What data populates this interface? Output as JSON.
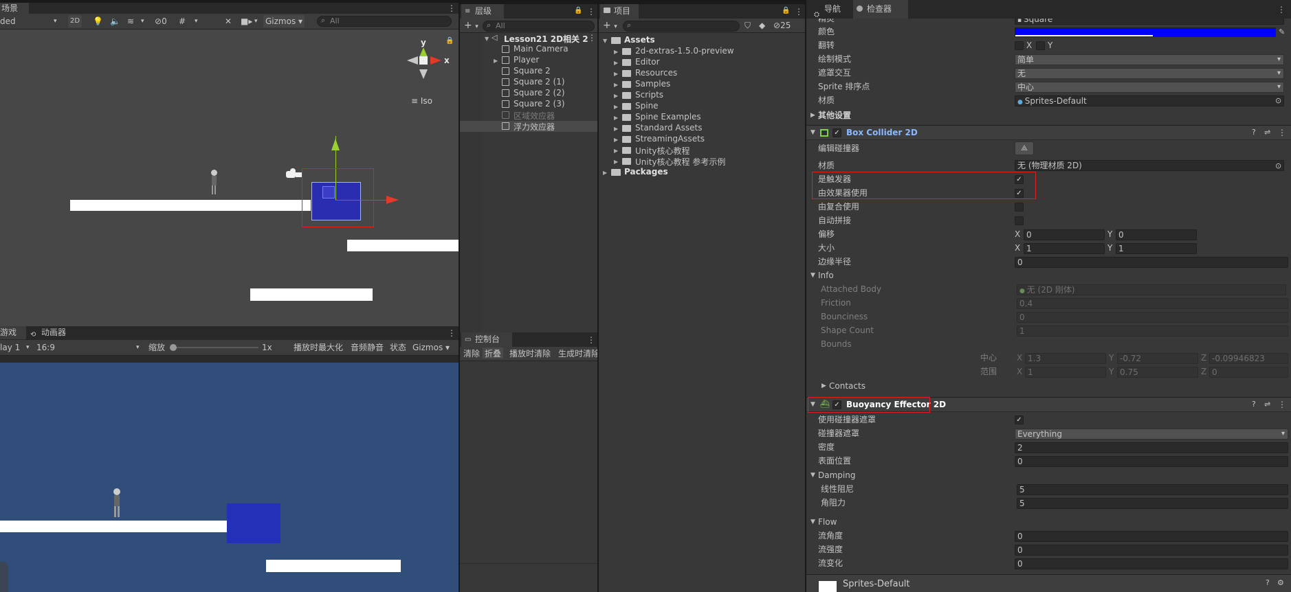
{
  "scene": {
    "tab": "场景",
    "shading": "ded",
    "btn_2d": "2D",
    "hidden_count": "0",
    "gizmos": "Gizmos",
    "search_placeholder": "All",
    "axis_y": "y",
    "axis_x": "x",
    "iso": "Iso"
  },
  "game": {
    "tabs": [
      "游戏",
      "动画器"
    ],
    "display": "lay 1",
    "aspect": "16:9",
    "scale_label": "缩放",
    "scale_value": "1x",
    "buttons": [
      "播放时最大化",
      "音频静音",
      "状态",
      "Gizmos"
    ]
  },
  "hierarchy": {
    "tab": "层级",
    "search_placeholder": "All",
    "scene_name": "Lesson21 2D相关 2",
    "items": [
      {
        "label": "Main Camera",
        "dim": false
      },
      {
        "label": "Player",
        "dim": false
      },
      {
        "label": "Square 2",
        "dim": false
      },
      {
        "label": "Square 2 (1)",
        "dim": false
      },
      {
        "label": "Square 2 (2)",
        "dim": false
      },
      {
        "label": "Square 2 (3)",
        "dim": false
      },
      {
        "label": "区域效应器",
        "dim": true
      },
      {
        "label": "浮力效应器",
        "dim": false
      }
    ]
  },
  "console": {
    "tab": "控制台",
    "buttons": [
      "清除",
      "折叠",
      "播放时清除",
      "生成时清除"
    ]
  },
  "project": {
    "tab": "项目",
    "hidden_count": "25",
    "root": "Assets",
    "folders": [
      "2d-extras-1.5.0-preview",
      "Editor",
      "Resources",
      "Samples",
      "Scripts",
      "Spine",
      "Spine Examples",
      "Standard Assets",
      "StreamingAssets",
      "Unity核心教程",
      "Unity核心教程 参考示例"
    ],
    "packages": "Packages"
  },
  "inspector": {
    "tabs": [
      "导航",
      "检查器"
    ],
    "sprite_renderer": {
      "sprite_label": "精灵",
      "sprite_value": "Square",
      "color_label": "颜色",
      "color": "#0000ff",
      "flip_label": "翻转",
      "flip_x": "X",
      "flip_y": "Y",
      "draw_mode_label": "绘制模式",
      "draw_mode": "简单",
      "mask_label": "遮罩交互",
      "mask": "无",
      "sort_point_label": "Sprite 排序点",
      "sort_point": "中心",
      "material_label": "材质",
      "material": "Sprites-Default",
      "other_settings": "其他设置"
    },
    "box_collider": {
      "title": "Box Collider 2D",
      "edit_label": "编辑碰撞器",
      "material_label": "材质",
      "material": "无 (物理材质 2D)",
      "is_trigger_label": "是触发器",
      "used_by_effector_label": "由效果器使用",
      "used_by_composite_label": "由复合使用",
      "auto_tiling_label": "自动拼接",
      "offset_label": "偏移",
      "offset_x": "0",
      "offset_y": "0",
      "size_label": "大小",
      "size_x": "1",
      "size_y": "1",
      "edge_radius_label": "边缘半径",
      "edge_radius": "0",
      "info_label": "Info",
      "attached_body_label": "Attached Body",
      "attached_body": "无 (2D 刚体)",
      "friction_label": "Friction",
      "friction": "0.4",
      "bounciness_label": "Bounciness",
      "bounciness": "0",
      "shape_count_label": "Shape Count",
      "shape_count": "1",
      "bounds_label": "Bounds",
      "center_label": "中心",
      "center_x": "1.3",
      "center_y": "-0.72",
      "center_z": "-0.09946823",
      "extent_label": "范围",
      "extent_x": "1",
      "extent_y": "0.75",
      "extent_z": "0",
      "contacts_label": "Contacts"
    },
    "buoyancy": {
      "title": "Buoyancy Effector 2D",
      "use_mask_label": "使用碰撞器遮罩",
      "mask_label": "碰撞器遮罩",
      "mask": "Everything",
      "density_label": "密度",
      "density": "2",
      "surface_label": "表面位置",
      "surface": "0",
      "damping_label": "Damping",
      "linear_label": "线性阻尼",
      "linear": "5",
      "angular_label": "角阻力",
      "angular": "5",
      "flow_label": "Flow",
      "flow_angle_label": "流角度",
      "flow_angle": "0",
      "flow_mag_label": "流强度",
      "flow_mag": "0",
      "flow_var_label": "流变化",
      "flow_var": "0"
    },
    "footer_material": "Sprites-Default"
  }
}
